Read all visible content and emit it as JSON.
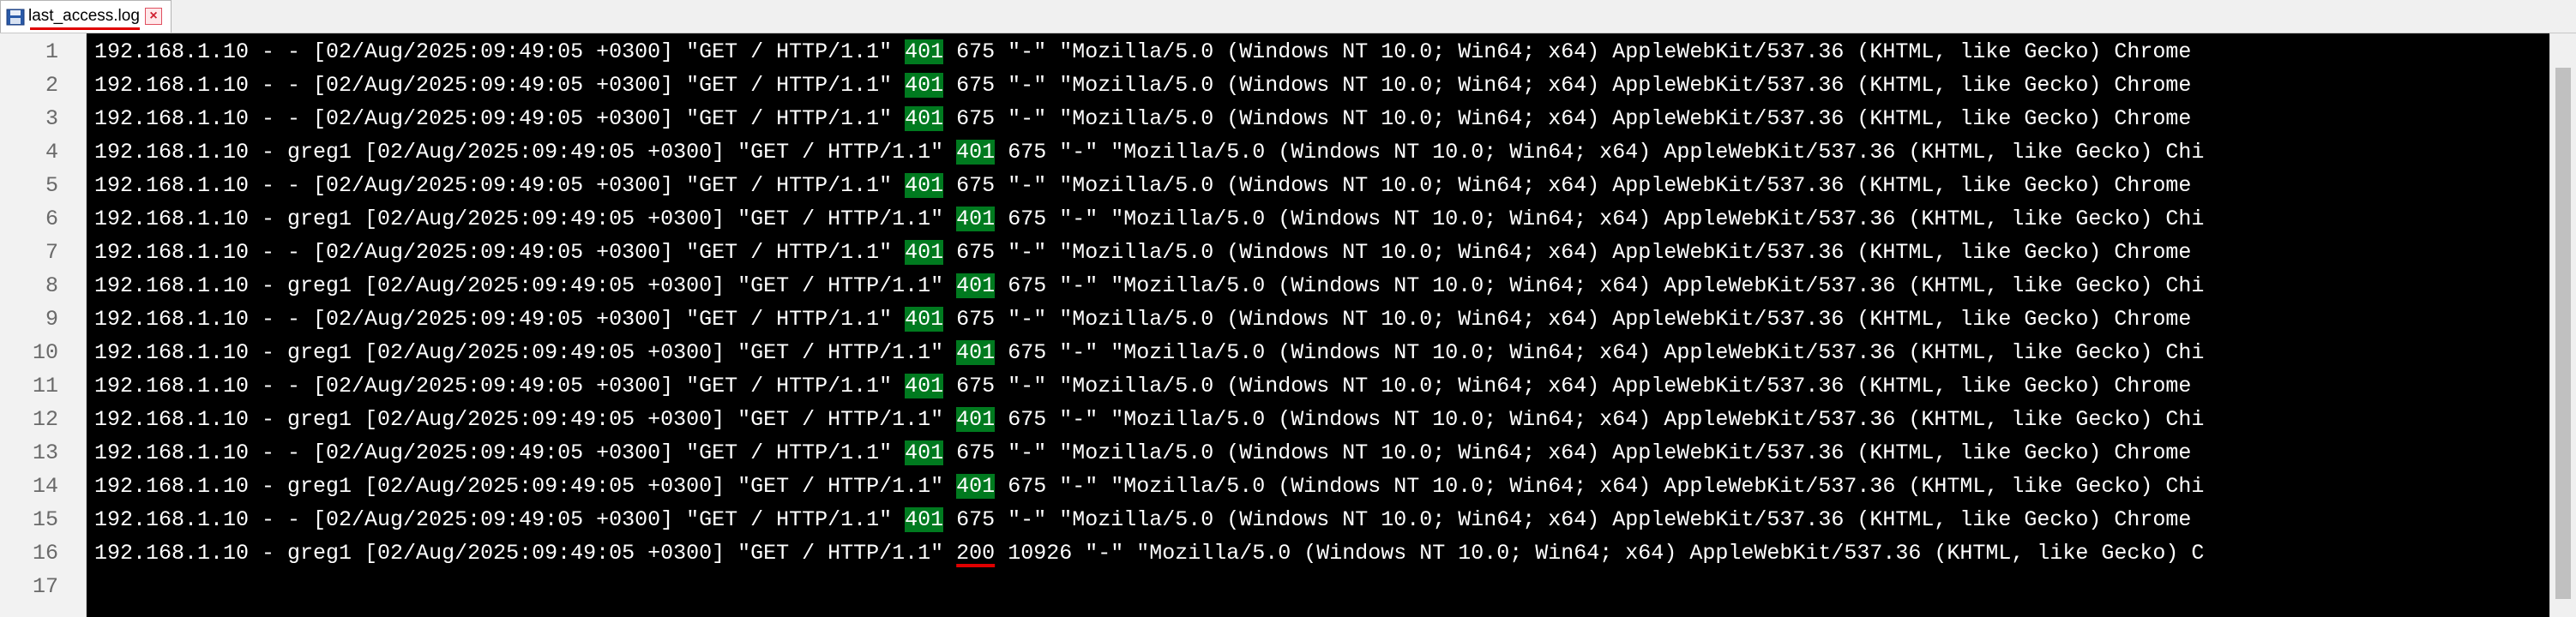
{
  "tab": {
    "filename": "last_access.log",
    "close_glyph": "×",
    "save_icon": "floppy-disk-icon",
    "close_icon": "close-icon"
  },
  "gutter": {
    "line_numbers": [
      "1",
      "2",
      "3",
      "4",
      "5",
      "6",
      "7",
      "8",
      "9",
      "10",
      "11",
      "12",
      "13",
      "14",
      "15",
      "16",
      "17"
    ]
  },
  "editor": {
    "lines": [
      {
        "pre": "192.168.1.10 - - [02/Aug/2025:09:49:05 +0300] \"GET / HTTP/1.1\" ",
        "status": "401",
        "post": " 675 \"-\" \"Mozilla/5.0 (Windows NT 10.0; Win64; x64) AppleWebKit/537.36 (KHTML, like Gecko) Chrome"
      },
      {
        "pre": "192.168.1.10 - - [02/Aug/2025:09:49:05 +0300] \"GET / HTTP/1.1\" ",
        "status": "401",
        "post": " 675 \"-\" \"Mozilla/5.0 (Windows NT 10.0; Win64; x64) AppleWebKit/537.36 (KHTML, like Gecko) Chrome"
      },
      {
        "pre": "192.168.1.10 - - [02/Aug/2025:09:49:05 +0300] \"GET / HTTP/1.1\" ",
        "status": "401",
        "post": " 675 \"-\" \"Mozilla/5.0 (Windows NT 10.0; Win64; x64) AppleWebKit/537.36 (KHTML, like Gecko) Chrome"
      },
      {
        "pre": "192.168.1.10 - greg1 [02/Aug/2025:09:49:05 +0300] \"GET / HTTP/1.1\" ",
        "status": "401",
        "post": " 675 \"-\" \"Mozilla/5.0 (Windows NT 10.0; Win64; x64) AppleWebKit/537.36 (KHTML, like Gecko) Chi"
      },
      {
        "pre": "192.168.1.10 - - [02/Aug/2025:09:49:05 +0300] \"GET / HTTP/1.1\" ",
        "status": "401",
        "post": " 675 \"-\" \"Mozilla/5.0 (Windows NT 10.0; Win64; x64) AppleWebKit/537.36 (KHTML, like Gecko) Chrome"
      },
      {
        "pre": "192.168.1.10 - greg1 [02/Aug/2025:09:49:05 +0300] \"GET / HTTP/1.1\" ",
        "status": "401",
        "post": " 675 \"-\" \"Mozilla/5.0 (Windows NT 10.0; Win64; x64) AppleWebKit/537.36 (KHTML, like Gecko) Chi"
      },
      {
        "pre": "192.168.1.10 - - [02/Aug/2025:09:49:05 +0300] \"GET / HTTP/1.1\" ",
        "status": "401",
        "post": " 675 \"-\" \"Mozilla/5.0 (Windows NT 10.0; Win64; x64) AppleWebKit/537.36 (KHTML, like Gecko) Chrome"
      },
      {
        "pre": "192.168.1.10 - greg1 [02/Aug/2025:09:49:05 +0300] \"GET / HTTP/1.1\" ",
        "status": "401",
        "post": " 675 \"-\" \"Mozilla/5.0 (Windows NT 10.0; Win64; x64) AppleWebKit/537.36 (KHTML, like Gecko) Chi"
      },
      {
        "pre": "192.168.1.10 - - [02/Aug/2025:09:49:05 +0300] \"GET / HTTP/1.1\" ",
        "status": "401",
        "post": " 675 \"-\" \"Mozilla/5.0 (Windows NT 10.0; Win64; x64) AppleWebKit/537.36 (KHTML, like Gecko) Chrome"
      },
      {
        "pre": "192.168.1.10 - greg1 [02/Aug/2025:09:49:05 +0300] \"GET / HTTP/1.1\" ",
        "status": "401",
        "post": " 675 \"-\" \"Mozilla/5.0 (Windows NT 10.0; Win64; x64) AppleWebKit/537.36 (KHTML, like Gecko) Chi"
      },
      {
        "pre": "192.168.1.10 - - [02/Aug/2025:09:49:05 +0300] \"GET / HTTP/1.1\" ",
        "status": "401",
        "post": " 675 \"-\" \"Mozilla/5.0 (Windows NT 10.0; Win64; x64) AppleWebKit/537.36 (KHTML, like Gecko) Chrome"
      },
      {
        "pre": "192.168.1.10 - greg1 [02/Aug/2025:09:49:05 +0300] \"GET / HTTP/1.1\" ",
        "status": "401",
        "post": " 675 \"-\" \"Mozilla/5.0 (Windows NT 10.0; Win64; x64) AppleWebKit/537.36 (KHTML, like Gecko) Chi"
      },
      {
        "pre": "192.168.1.10 - - [02/Aug/2025:09:49:05 +0300] \"GET / HTTP/1.1\" ",
        "status": "401",
        "post": " 675 \"-\" \"Mozilla/5.0 (Windows NT 10.0; Win64; x64) AppleWebKit/537.36 (KHTML, like Gecko) Chrome"
      },
      {
        "pre": "192.168.1.10 - greg1 [02/Aug/2025:09:49:05 +0300] \"GET / HTTP/1.1\" ",
        "status": "401",
        "post": " 675 \"-\" \"Mozilla/5.0 (Windows NT 10.0; Win64; x64) AppleWebKit/537.36 (KHTML, like Gecko) Chi"
      },
      {
        "pre": "192.168.1.10 - - [02/Aug/2025:09:49:05 +0300] \"GET / HTTP/1.1\" ",
        "status": "401",
        "post": " 675 \"-\" \"Mozilla/5.0 (Windows NT 10.0; Win64; x64) AppleWebKit/537.36 (KHTML, like Gecko) Chrome"
      },
      {
        "pre": "192.168.1.10 - greg1 [02/Aug/2025:09:49:05 +0300] \"GET / HTTP/1.1\" ",
        "status": "200",
        "post": " 10926 \"-\" \"Mozilla/5.0 (Windows NT 10.0; Win64; x64) AppleWebKit/537.36 (KHTML, like Gecko) C"
      },
      {
        "pre": "",
        "status": "",
        "post": ""
      }
    ],
    "highlight_colors": {
      "status_401": "#007a1f",
      "status_200_underline": "#e00000"
    }
  }
}
